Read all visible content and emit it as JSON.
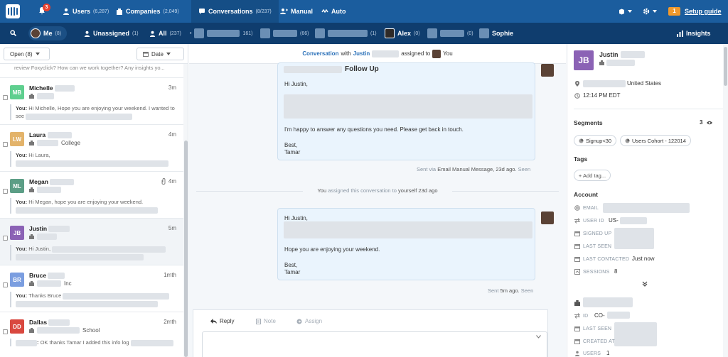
{
  "topnav": {
    "notif_count": "3",
    "users_label": "Users",
    "users_count": "(6,287)",
    "companies_label": "Companies",
    "companies_count": "(2,049)",
    "conversations_label": "Conversations",
    "conversations_count": "(8/237)",
    "manual_label": "Manual",
    "auto_label": "Auto",
    "setup_badge": "1",
    "setup_label": "Setup guide"
  },
  "subnav": {
    "me_label": "Me",
    "me_count": "(8)",
    "unassigned_label": "Unassigned",
    "unassigned_count": "(1)",
    "all_label": "All",
    "all_count": "(237)",
    "team1_count": "161)",
    "team2_count": "(66)",
    "team3_count": "(1)",
    "alex_label": "Alex",
    "alex_count": "(0)",
    "team4_count": "(0)",
    "sophie_label": "Sophie",
    "insights_label": "Insights"
  },
  "filters": {
    "status": "Open (8)",
    "sort": "Date"
  },
  "conversations": [
    {
      "initials": "MB",
      "color": "#5fcf8f",
      "name": "Michelle",
      "time": "3m",
      "company": "",
      "you": "You:",
      "snippet": "Hi Michelle, Hope you are enjoying your weekend. I wanted to see",
      "selected": false
    },
    {
      "initials": "LW",
      "color": "#e3b36a",
      "name": "Laura",
      "time": "4m",
      "company": "College",
      "you": "You:",
      "snippet": "Hi Laura,",
      "selected": false
    },
    {
      "initials": "ML",
      "color": "#5c9e86",
      "name": "Megan",
      "time": "4m",
      "company": "",
      "you": "You:",
      "snippet": "Hi Megan, hope you are enjoying your weekend.",
      "selected": false
    },
    {
      "initials": "JB",
      "color": "#8b62b5",
      "name": "Justin",
      "time": "5m",
      "company": "",
      "you": "You:",
      "snippet": "Hi Justin,",
      "selected": true
    },
    {
      "initials": "BR",
      "color": "#7b9ee0",
      "name": "Bruce",
      "time": "1mth",
      "company": "Inc",
      "you": "You:",
      "snippet": "Thanks Bruce",
      "selected": false
    },
    {
      "initials": "DD",
      "color": "#d9483f",
      "name": "Dallas",
      "time": "2mth",
      "company": "School",
      "you": ":",
      "snippet": "OK thanks Tamar I added this info log",
      "selected": false
    }
  ],
  "convhead": {
    "conversation_word": "Conversation",
    "with_word": "with",
    "user_name": "Justin",
    "assigned_word": "assigned to",
    "assignee": "You"
  },
  "messages": {
    "m1_title": "Follow Up",
    "m1_greeting": "Hi Justin,",
    "m1_body": "I'm happy to answer any questions you need. Please get back in touch.",
    "m1_sign1": "Best,",
    "m1_sign2": "Tamar",
    "m1_meta_pre": "Sent via",
    "m1_meta_type": "Email Manual Message,",
    "m1_meta_time": "23d ago.",
    "m1_meta_seen": "Seen",
    "sys_you": "You",
    "sys_text": "assigned this conversation to",
    "sys_target": "yourself",
    "sys_time": "23d ago",
    "m2_greeting": "Hi Justin,",
    "m2_body": "Hope you are enjoying your weekend.",
    "m2_sign1": "Best,",
    "m2_sign2": "Tamar",
    "m2_meta_pre": "Sent",
    "m2_meta_time": "5m ago.",
    "m2_meta_seen": "Seen"
  },
  "composer": {
    "reply": "Reply",
    "note": "Note",
    "assign": "Assign"
  },
  "profile": {
    "initials": "JB",
    "name": "Justin",
    "location": "United States",
    "local_time": "12:14 PM EDT",
    "segments_title": "Segments",
    "segments_count": "3",
    "segment1": "Signup<30",
    "segment2": "Users Cohort - 122014",
    "tags_title": "Tags",
    "add_tag": "+ Add tag...",
    "account_title": "Account",
    "email_label": "EMAIL",
    "userid_label": "USER ID",
    "userid_value": "US-",
    "signedup_label": "SIGNED UP",
    "lastseen_label": "LAST SEEN",
    "lastcontacted_label": "LAST CONTACTED",
    "lastcontacted_value": "Just now",
    "sessions_label": "SESSIONS",
    "sessions_value": "8",
    "company_id_label": "ID",
    "company_id_value": "CO-",
    "company_lastseen_label": "LAST SEEN",
    "company_created_label": "CREATED AT",
    "company_users_label": "USERS",
    "company_users_value": "1"
  }
}
